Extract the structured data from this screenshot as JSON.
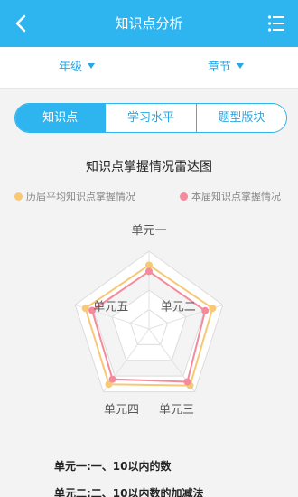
{
  "header": {
    "title": "知识点分析",
    "back_icon": "back-arrow-icon",
    "menu_icon": "list-menu-icon",
    "bg_color": "#2eb4ee"
  },
  "filters": {
    "grade_label": "年级",
    "chapter_label": "章节"
  },
  "tabs": [
    {
      "label": "知识点",
      "active": true
    },
    {
      "label": "学习水平",
      "active": false
    },
    {
      "label": "题型版块",
      "active": false
    }
  ],
  "chart_data": {
    "type": "radar",
    "title": "知识点掌握情况雷达图",
    "axes": [
      "单元一",
      "单元二",
      "单元三",
      "单元四",
      "单元五"
    ],
    "rmax": 1,
    "series": [
      {
        "name": "历届平均知识点掌握情况",
        "color": "#f7c876",
        "values": [
          0.82,
          0.86,
          0.9,
          0.88,
          0.86
        ]
      },
      {
        "name": "本届知识点掌握情况",
        "color": "#f48a9c",
        "values": [
          0.74,
          0.76,
          0.84,
          0.8,
          0.77
        ]
      }
    ]
  },
  "descriptions": [
    "单元一:一、10以内的数",
    "单元二:二、10以内数的加减法"
  ]
}
